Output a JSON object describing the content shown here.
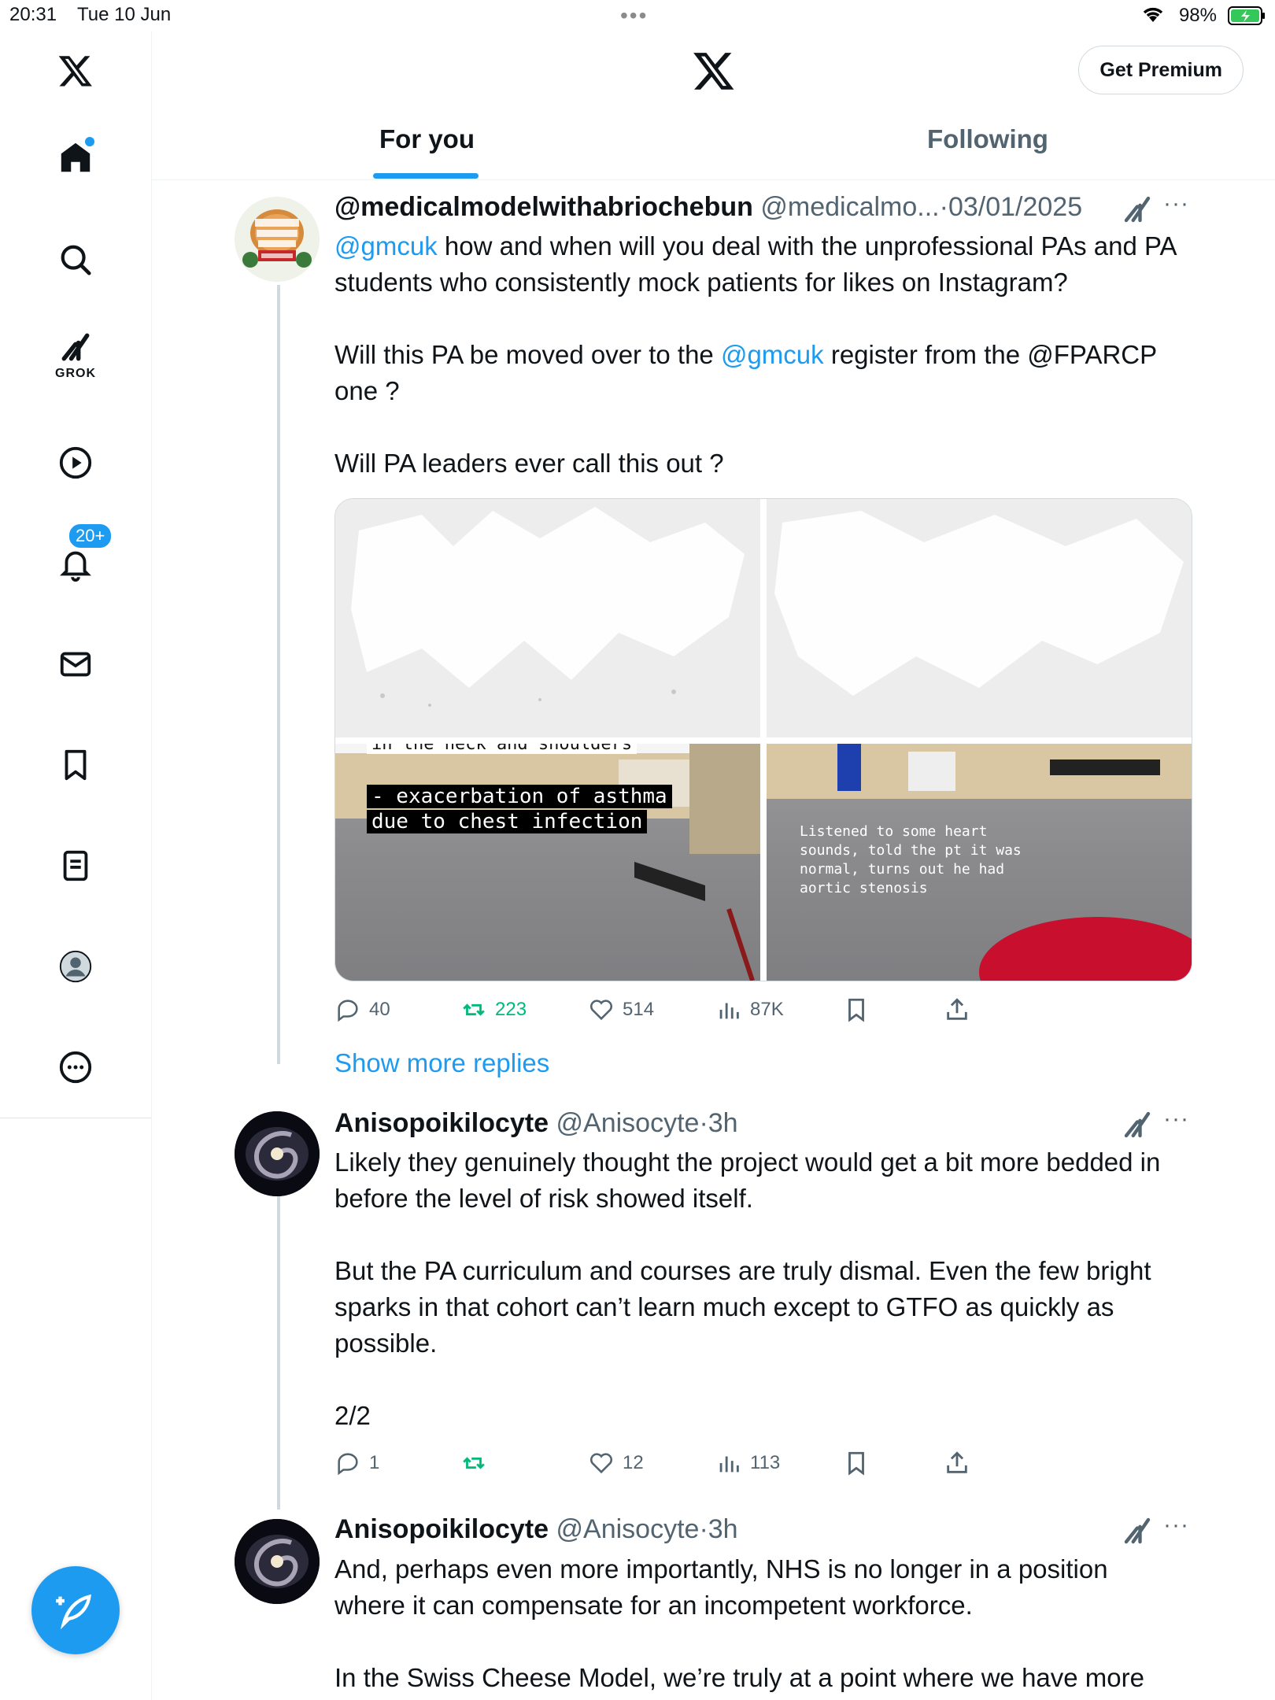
{
  "status_bar": {
    "time": "20:31",
    "date": "Tue 10 Jun",
    "battery_percent": "98%"
  },
  "sidebar": {
    "items": [
      {
        "name": "home",
        "icon": "home-icon"
      },
      {
        "name": "search",
        "icon": "search-icon"
      },
      {
        "name": "grok",
        "icon": "grok-icon",
        "label": "GROK"
      },
      {
        "name": "video",
        "icon": "play-icon"
      },
      {
        "name": "notifications",
        "icon": "bell-icon",
        "badge": "20+"
      },
      {
        "name": "messages",
        "icon": "mail-icon"
      },
      {
        "name": "bookmarks",
        "icon": "bookmark-icon"
      },
      {
        "name": "lists",
        "icon": "list-icon"
      },
      {
        "name": "profile",
        "icon": "profile-icon"
      },
      {
        "name": "more",
        "icon": "more-icon"
      }
    ]
  },
  "header": {
    "premium_label": "Get Premium",
    "tabs": [
      {
        "label": "For you",
        "active": true
      },
      {
        "label": "Following",
        "active": false
      }
    ]
  },
  "posts": [
    {
      "name": "@medicalmodelwithabriochebun",
      "handle": "@medicalmo...",
      "separator": "·",
      "time": "03/01/2025",
      "text_parts": [
        {
          "t": "@gmcuk",
          "mention": true
        },
        {
          "t": " how and when will you deal with the unprofessional PAs and PA students who consistently mock patients for likes on Instagram?\n\nWill this PA be moved over to the ",
          "mention": false
        },
        {
          "t": "@gmcuk",
          "mention": true
        },
        {
          "t": " register from the @FPARCP one ?\n\nWill PA leaders ever call this out ?",
          "mention": false
        }
      ],
      "media_text": {
        "caption_top": "in the neck and shoulders",
        "caption_line1": "- exacerbation of asthma",
        "caption_line2": "due to chest infection",
        "caption_right": "Listened to some heart\nsounds, told the pt it was\nnormal, turns out he had\naortic stenosis"
      },
      "stats": {
        "replies": "40",
        "reposts": "223",
        "likes": "514",
        "views": "87K"
      }
    },
    {
      "name": "Anisopoikilocyte",
      "handle": "@Anisocyte",
      "separator": "·",
      "time": "3h",
      "text": "Likely they genuinely thought the project would get a bit more bedded in before the level of risk showed itself.\n\nBut the PA curriculum and courses are truly dismal. Even the few bright sparks in that cohort can’t learn much except to GTFO as quickly as possible.\n\n2/2",
      "stats": {
        "replies": "1",
        "reposts": "",
        "likes": "12",
        "views": "113"
      }
    },
    {
      "name": "Anisopoikilocyte",
      "handle": "@Anisocyte",
      "separator": "·",
      "time": "3h",
      "text": "And, perhaps even more importantly, NHS is no longer in a position where it can compensate for an incompetent workforce.\n\nIn the Swiss Cheese Model, we’re truly at a point where we have more"
    }
  ],
  "show_more_replies": "Show more replies",
  "colors": {
    "accent": "#1d9bf0",
    "repost_green": "#00ba7c",
    "muted": "#536471"
  }
}
